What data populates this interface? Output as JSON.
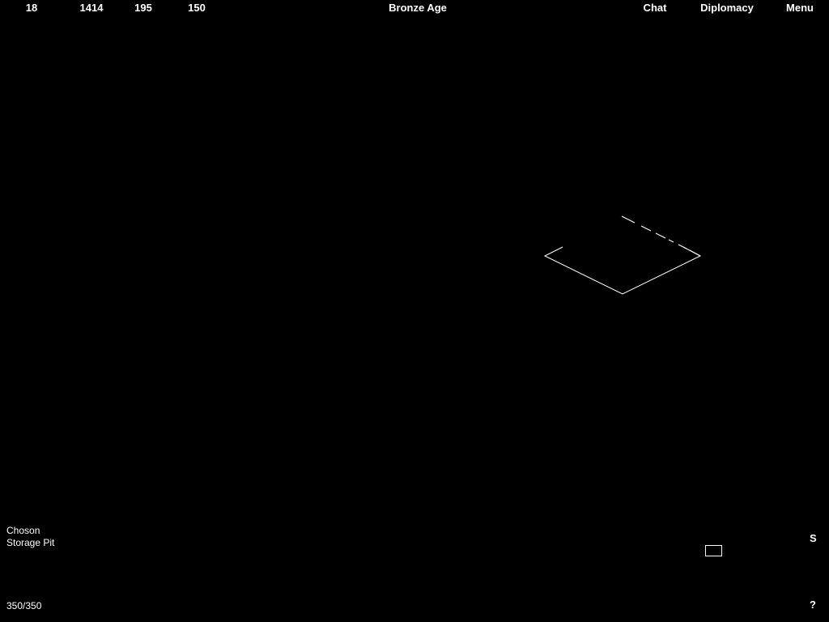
{
  "resources": {
    "food": "18",
    "wood": "1414",
    "stone": "195",
    "gold": "150"
  },
  "age": "Bronze Age",
  "menu": {
    "chat": "Chat",
    "diplomacy": "Diplomacy",
    "menu": "Menu"
  },
  "selection": {
    "civilization": "Choson",
    "building": "Storage Pit",
    "hit_points": "350/350"
  },
  "minimap": {
    "signal_button": "S",
    "help_button": "?"
  },
  "colors": {
    "background": "#000000",
    "foreground": "#ffffff"
  }
}
